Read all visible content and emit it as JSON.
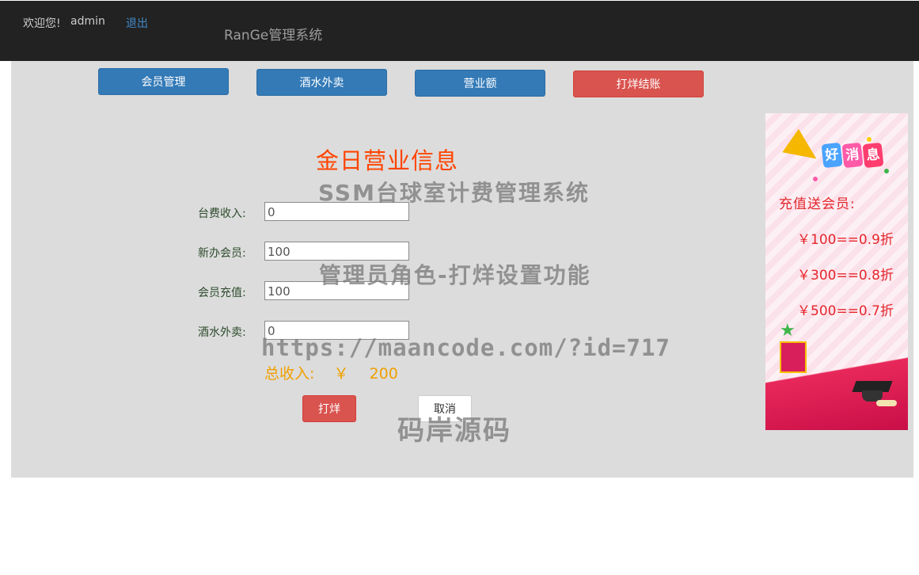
{
  "header": {
    "welcome": "欢迎您!",
    "username": "admin",
    "logout": "退出",
    "brand": "RanGe管理系统"
  },
  "nav": {
    "member": "会员管理",
    "drinks": "酒水外卖",
    "revenue": "营业额",
    "close": "打烊结账"
  },
  "form": {
    "title": "金日营业信息",
    "table_fee_label": "台费收入:",
    "table_fee_value": "0",
    "new_member_label": "新办会员:",
    "new_member_value": "100",
    "recharge_label": "会员充值:",
    "recharge_value": "100",
    "drinks_label": "酒水外卖:",
    "drinks_value": "0",
    "total_label": "总收入:",
    "total_currency": "￥",
    "total_value": "200",
    "submit": "打烊",
    "cancel": "取消"
  },
  "watermarks": {
    "line1": "SSM台球室计费管理系统",
    "line2": "管理员角色-打烊设置功能",
    "line3": "https://maancode.com/?id=717",
    "line4": "码岸源码"
  },
  "promo": {
    "badge": [
      "好",
      "消",
      "息"
    ],
    "heading": "充值送会员:",
    "rates": [
      "￥100==0.9折",
      "￥300==0.8折",
      "￥500==0.7折"
    ]
  },
  "colors": {
    "topbar": "#222222",
    "primary": "#337ab7",
    "danger": "#d9534f",
    "title": "#ff4400",
    "total": "#f0a000",
    "promo_text": "#e5262c"
  }
}
